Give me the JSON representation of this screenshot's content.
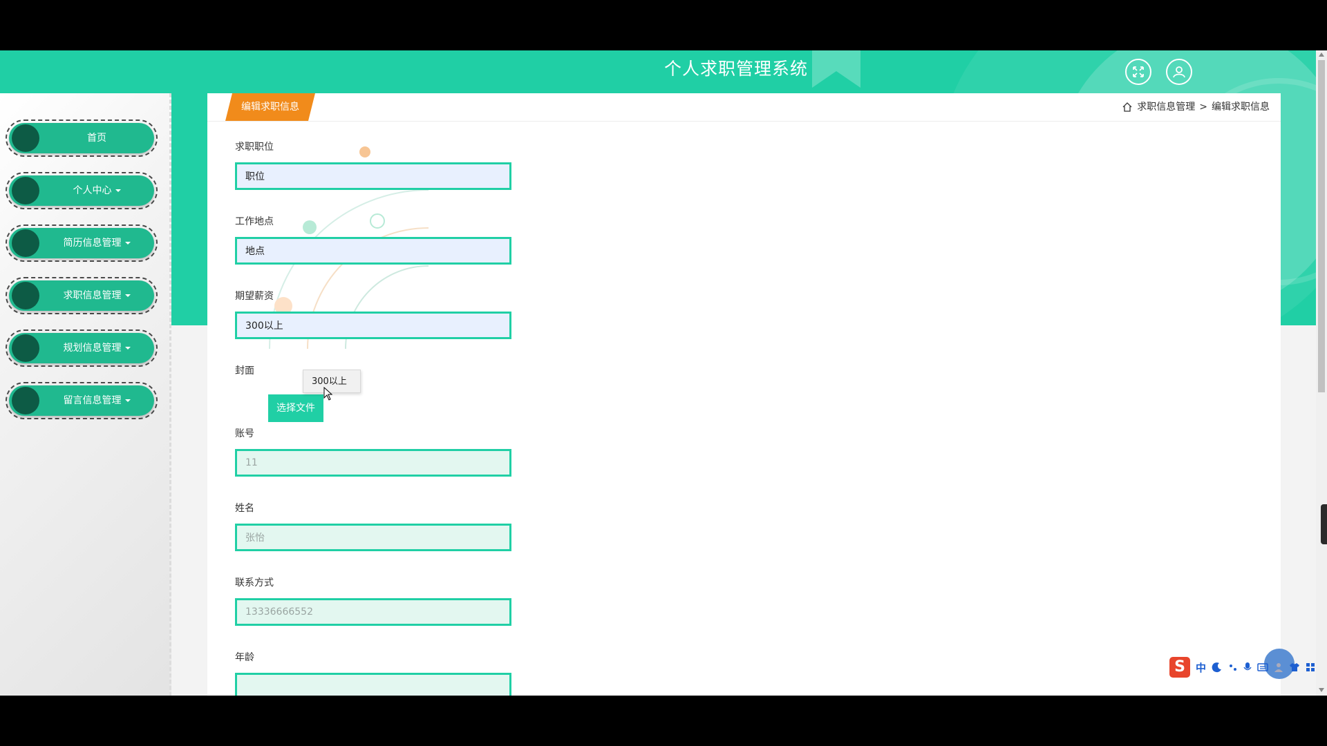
{
  "header": {
    "title": "个人求职管理系统"
  },
  "sidebar": {
    "items": [
      {
        "label": "首页",
        "dropdown": false
      },
      {
        "label": "个人中心",
        "dropdown": true
      },
      {
        "label": "简历信息管理",
        "dropdown": true
      },
      {
        "label": "求职信息管理",
        "dropdown": true
      },
      {
        "label": "规划信息管理",
        "dropdown": true
      },
      {
        "label": "留言信息管理",
        "dropdown": true
      }
    ]
  },
  "page": {
    "tab_title": "编辑求职信息",
    "breadcrumb": {
      "parent": "求职信息管理",
      "separator": ">",
      "current": "编辑求职信息"
    }
  },
  "form": {
    "position": {
      "label": "求职职位",
      "value": "职位"
    },
    "location": {
      "label": "工作地点",
      "value": "地点"
    },
    "salary": {
      "label": "期望薪资",
      "value": "300以上"
    },
    "cover": {
      "label": "封面",
      "button": "选择文件"
    },
    "account": {
      "label": "账号",
      "value": "11"
    },
    "name": {
      "label": "姓名",
      "value": "张怡"
    },
    "contact": {
      "label": "联系方式",
      "value": "13336666552"
    },
    "age": {
      "label": "年龄",
      "value": ""
    }
  },
  "tooltip": {
    "text": "300以上"
  },
  "ime": {
    "logo": "S",
    "mode": "中"
  },
  "colors": {
    "primary": "#20cfa5",
    "tab": "#f18b1b",
    "nav_pill": "#20b98f",
    "nav_dot": "#0d5b45"
  }
}
